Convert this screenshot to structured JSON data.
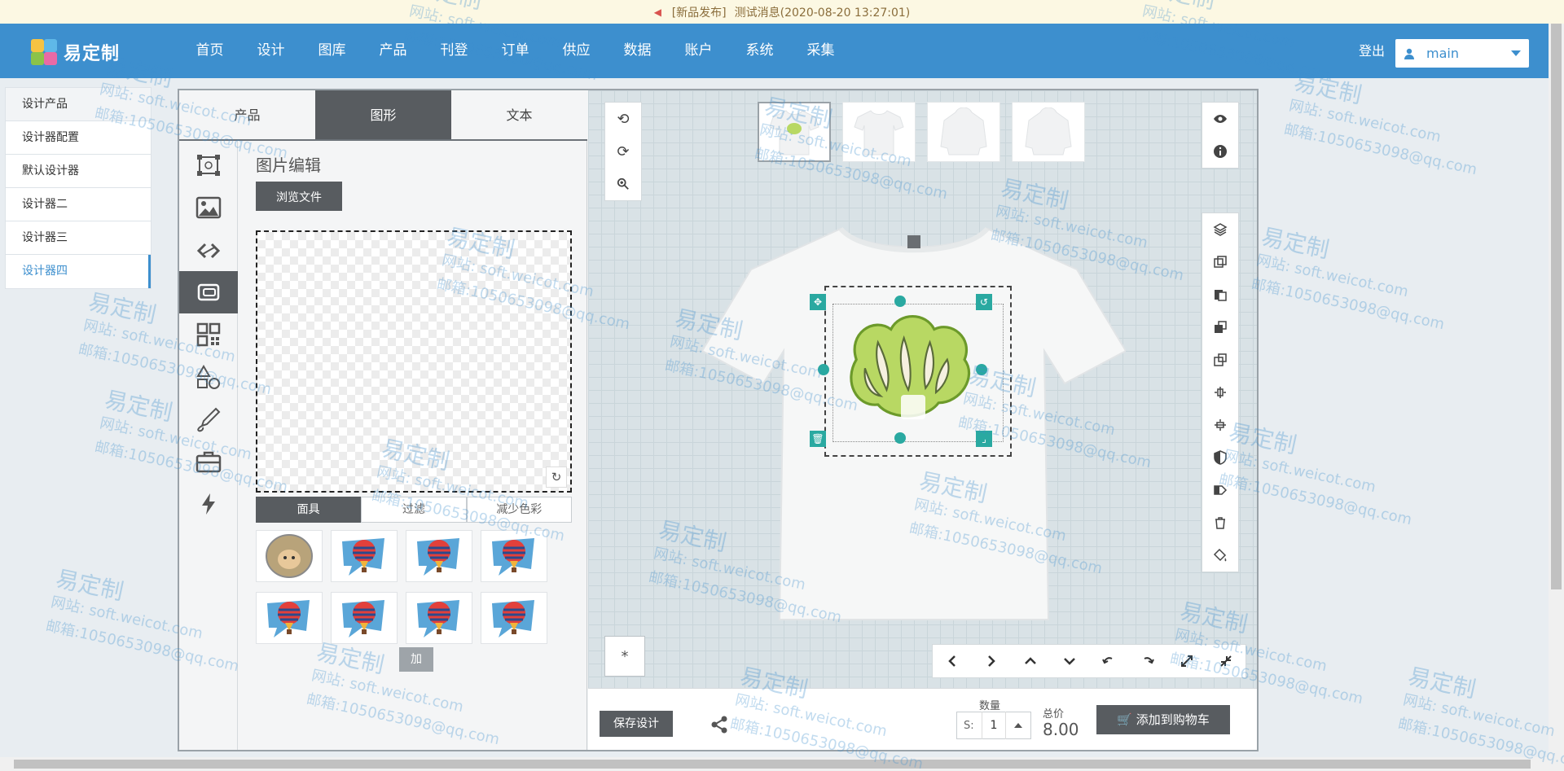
{
  "notice": {
    "tag": "[新品发布]",
    "message": "测试消息(2020-08-20 13:27:01)"
  },
  "brand": {
    "name": "易定制",
    "colors": {
      "primary": "#3d8fce",
      "accent": "#2aa9a1",
      "dark_button": "#585c60"
    }
  },
  "nav": {
    "items": [
      "首页",
      "设计",
      "图库",
      "产品",
      "刊登",
      "订单",
      "供应",
      "数据",
      "账户",
      "系统",
      "采集"
    ]
  },
  "header": {
    "logout": "登出",
    "user": "main"
  },
  "sidebar": {
    "items": [
      "设计产品",
      "设计器配置",
      "默认设计器",
      "设计器二",
      "设计器三",
      "设计器四"
    ],
    "active_index": 5
  },
  "designer": {
    "tabs": [
      "产品",
      "图形",
      "文本"
    ],
    "active_tab": 1,
    "tools": [
      "frame-icon",
      "image-icon",
      "link-icon",
      "image-edit-icon",
      "qr-code-icon",
      "shapes-icon",
      "pen-icon",
      "briefcase-icon",
      "flash-icon"
    ],
    "active_tool_index": 3,
    "panel": {
      "title": "图片编辑",
      "browse": "浏览文件",
      "subtabs": [
        "面具",
        "过滤",
        "减少色彩"
      ],
      "active_subtab": 0,
      "add": "加",
      "mask_count": 8
    },
    "stage": {
      "left_controls": [
        "undo-icon",
        "redo-icon",
        "zoom-icon"
      ],
      "view_count": 4,
      "star": "*"
    },
    "bottom": {
      "save": "保存设计",
      "qty_label": "数量",
      "size": "S:",
      "qty": "1",
      "price_label": "总价",
      "price": "8.00",
      "cart": "添加到购物车"
    }
  },
  "watermark": {
    "brand": "易定制",
    "site": "网站: soft.weicot.com",
    "mail": "邮箱:1050653098@qq.com"
  }
}
